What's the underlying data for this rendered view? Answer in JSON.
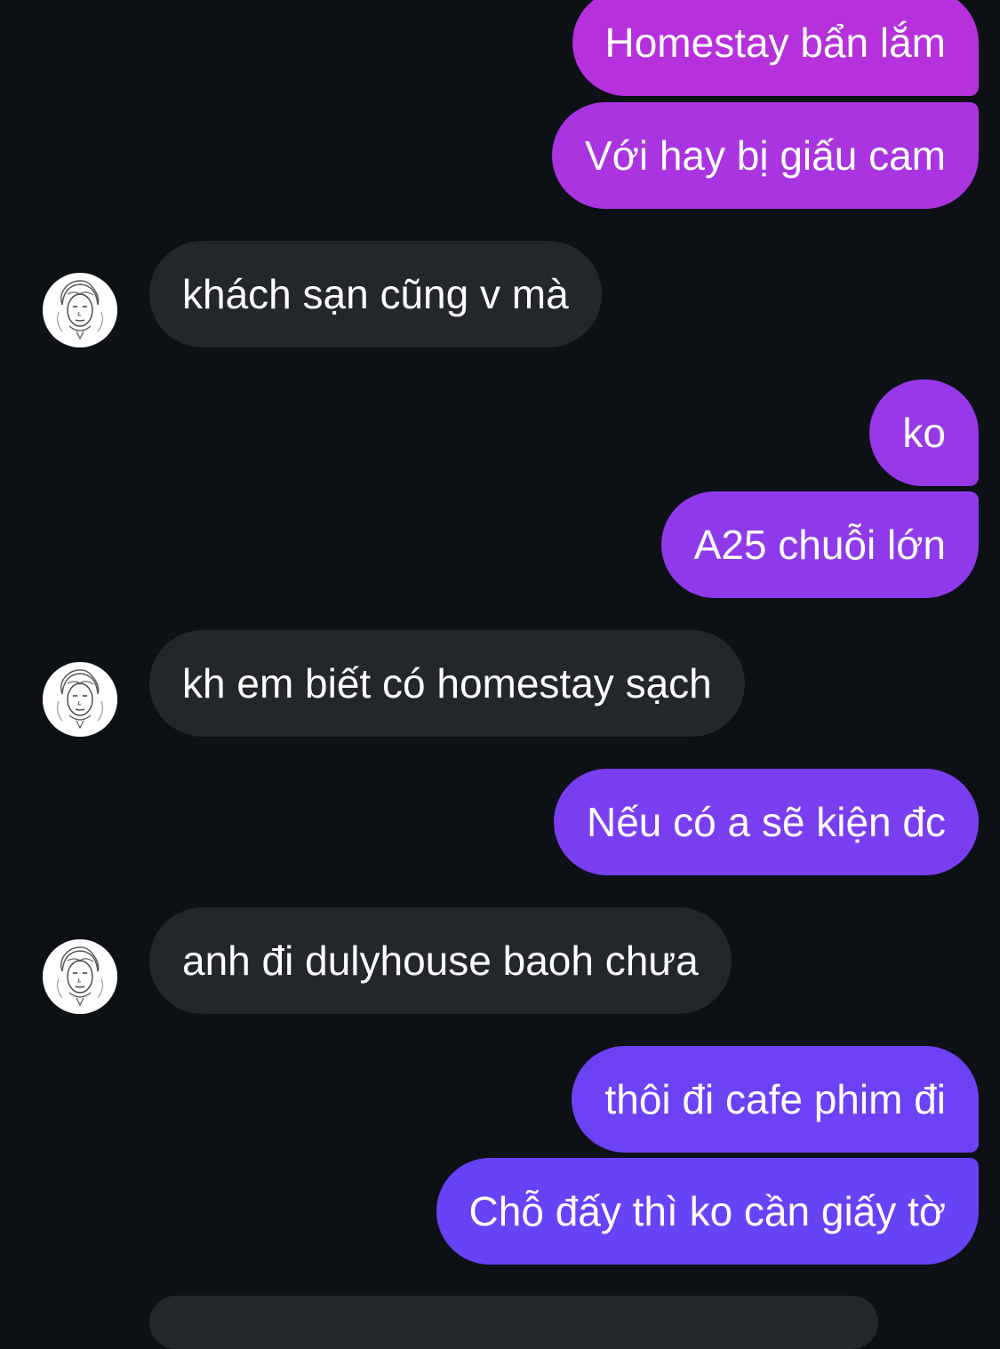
{
  "conversation": {
    "messages": [
      {
        "sender": "me",
        "text": "Homestay bẩn lắm",
        "color": "#b630dc"
      },
      {
        "sender": "me",
        "text": "Với hay bị giấu cam",
        "color": "#a934e0"
      },
      {
        "sender": "them",
        "text": "khách sạn cũng v mà",
        "color": "#23262b"
      },
      {
        "sender": "me",
        "text": "ko",
        "color": "#9638e7"
      },
      {
        "sender": "me",
        "text": "A25 chuỗi lớn",
        "color": "#8e3aea"
      },
      {
        "sender": "them",
        "text": "kh em biết có homestay sạch",
        "color": "#23262b"
      },
      {
        "sender": "me",
        "text": "Nếu có a sẽ kiện đc",
        "color": "#7a3ef1"
      },
      {
        "sender": "them",
        "text": "anh đi dulyhouse baoh chưa",
        "color": "#23262b"
      },
      {
        "sender": "me",
        "text": "thôi đi cafe phim đi",
        "color": "#6d41f5"
      },
      {
        "sender": "me",
        "text": "Chỗ đấy thì ko cần giấy tờ",
        "color": "#6842f6"
      }
    ]
  },
  "avatar": {
    "icon": "avatar-sketch-portrait"
  },
  "colors": {
    "background": "#0d1015",
    "incoming_bubble": "#23262b",
    "text": "#ffffff"
  }
}
